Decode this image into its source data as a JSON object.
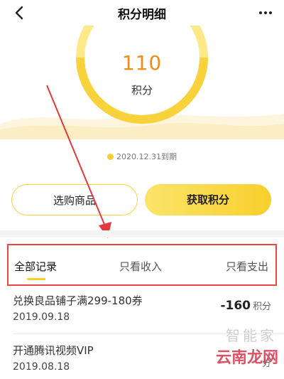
{
  "header": {
    "title": "积分明细",
    "back_icon": "chevron-left-icon",
    "more_icon": "more-dots-icon"
  },
  "summary": {
    "points": "110",
    "points_label": "积分",
    "expiry": "2020.12.31到期"
  },
  "actions": {
    "shop_label": "选购商品",
    "earn_label": "获取积分"
  },
  "tabs": [
    {
      "label": "全部记录",
      "active": true
    },
    {
      "label": "只看收入",
      "active": false
    },
    {
      "label": "只看支出",
      "active": false
    }
  ],
  "records": [
    {
      "name": "兑换良品铺子满299-180券",
      "date": "2019.09.18",
      "amount": "-160",
      "unit": "积分"
    },
    {
      "name": "开通腾讯视频VIP",
      "date": "2019.08.18",
      "amount": "",
      "unit": "分"
    }
  ],
  "watermark": {
    "text": "云南龙网",
    "sub": "智能家"
  },
  "colors": {
    "accent": "#f8cf2c",
    "points": "#f08c1a",
    "highlight": "#e8474a"
  }
}
